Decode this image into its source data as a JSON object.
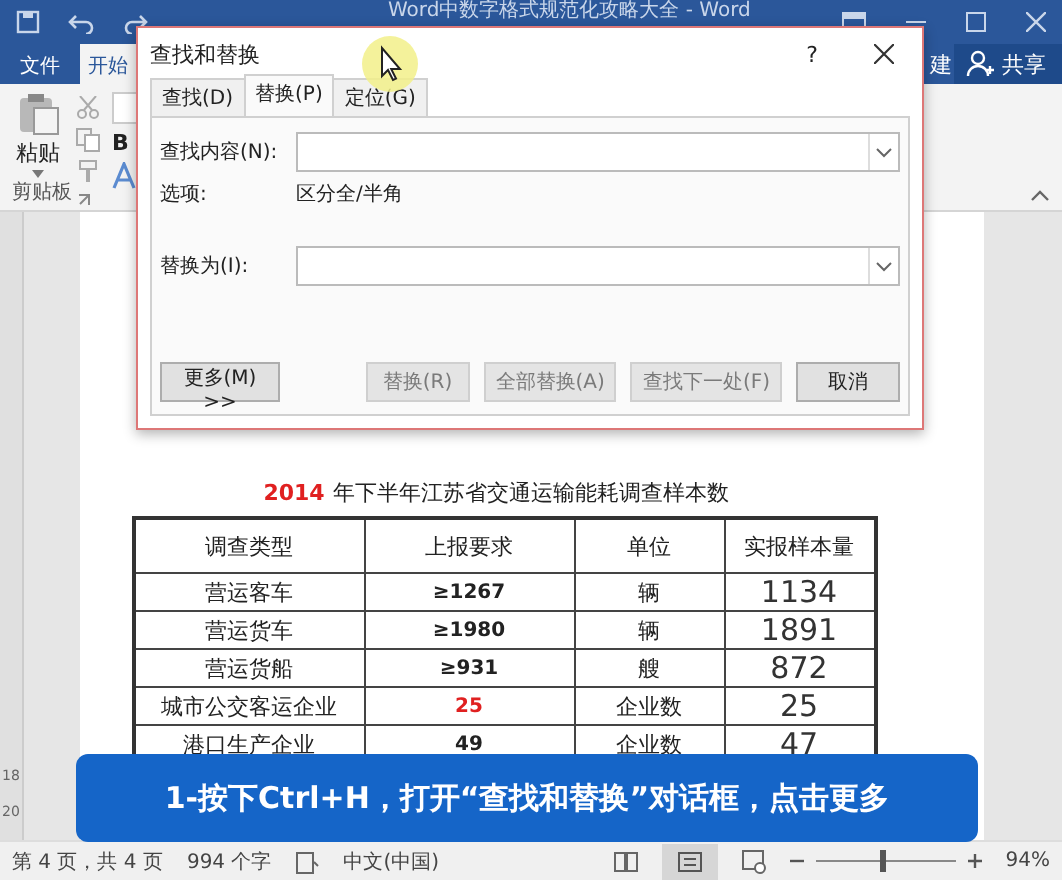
{
  "window": {
    "title": "Word中数字格式规范化攻略大全 - Word"
  },
  "ribbon_tabs": [
    {
      "label": "文件",
      "selected": false
    },
    {
      "label": "开始",
      "selected": true
    }
  ],
  "ribbon_tab_fragment": "建",
  "share_button": "共享",
  "clipboard": {
    "paste": "粘贴",
    "bold": "B",
    "group_label": "剪贴板"
  },
  "dialog": {
    "title": "查找和替换",
    "help": "?",
    "tabs": [
      {
        "label": "查找(D)",
        "selected": false
      },
      {
        "label": "替换(P)",
        "selected": true
      },
      {
        "label": "定位(G)",
        "selected": false
      }
    ],
    "find_label": "查找内容(N):",
    "options_label": "选项:",
    "options_value": "区分全/半角",
    "replace_label": "替换为(I):",
    "buttons": [
      {
        "label": "更多(M) >>",
        "disabled": false,
        "kind": "left"
      },
      {
        "label": "替换(R)",
        "disabled": true,
        "kind": "right"
      },
      {
        "label": "全部替换(A)",
        "disabled": true,
        "kind": "right"
      },
      {
        "label": "查找下一处(F)",
        "disabled": true,
        "kind": "right"
      },
      {
        "label": "取消",
        "disabled": false,
        "kind": "right"
      }
    ]
  },
  "document": {
    "title_year": "2014",
    "title_text": "年下半年江苏省交通运输能耗调查样本数",
    "columns": [
      "调查类型",
      "上报要求",
      "单位",
      "实报样本量"
    ],
    "rows": [
      [
        {
          "text": "营运客车",
          "highlight": false
        },
        {
          "text": "≥1267",
          "highlight": false
        },
        {
          "text": "辆",
          "highlight": false
        },
        {
          "text": "1134",
          "highlight": false
        }
      ],
      [
        {
          "text": "营运货车",
          "highlight": false
        },
        {
          "text": "≥1980",
          "highlight": false
        },
        {
          "text": "辆",
          "highlight": false
        },
        {
          "text": "1891",
          "highlight": false
        }
      ],
      [
        {
          "text": "营运货船",
          "highlight": false
        },
        {
          "text": "≥931",
          "highlight": false
        },
        {
          "text": "艘",
          "highlight": false
        },
        {
          "text": "872",
          "highlight": false
        }
      ],
      [
        {
          "text": "城市公交客运企业",
          "highlight": false
        },
        {
          "text": "25",
          "highlight": true
        },
        {
          "text": "企业数",
          "highlight": false
        },
        {
          "text": "25",
          "highlight": false
        }
      ],
      [
        {
          "text": "港口生产企业",
          "highlight": false
        },
        {
          "text": "49",
          "highlight": false
        },
        {
          "text": "企业数",
          "highlight": false
        },
        {
          "text": "47",
          "highlight": false
        }
      ]
    ]
  },
  "ruler_numbers": [
    "18",
    "20"
  ],
  "caption": "1-按下Ctrl+H，打开“查找和替换”对话框，点击更多",
  "status_bar": {
    "page": "第 4 页，共 4 页",
    "words": "994 个字",
    "language": "中文(中国)",
    "zoom": "94%",
    "zoom_slider": {
      "level": 0.47
    }
  }
}
